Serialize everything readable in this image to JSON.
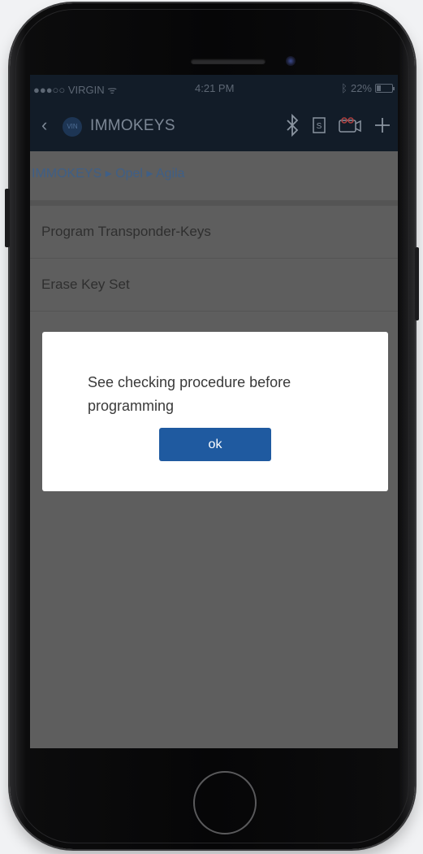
{
  "status_bar": {
    "carrier": "●●●○○ VIRGIN ᯤ",
    "time": "4:21 PM",
    "battery": "22%"
  },
  "nav": {
    "back_icon": "chevron-left-icon",
    "vin_badge": "VIN",
    "title": "IMMOKEYS",
    "icons": [
      "bluetooth-icon",
      "s-document-icon",
      "camera-car-icon",
      "plus-icon"
    ],
    "accent_color": "#1f5aa0"
  },
  "breadcrumb": "IMMOKEYS ▸ Opel ▸ Agila",
  "menu": {
    "items": [
      {
        "label": "Program Transponder-Keys"
      },
      {
        "label": "Erase Key Set"
      }
    ]
  },
  "dialog": {
    "message": "See checking procedure before programming",
    "ok_label": "ok"
  }
}
